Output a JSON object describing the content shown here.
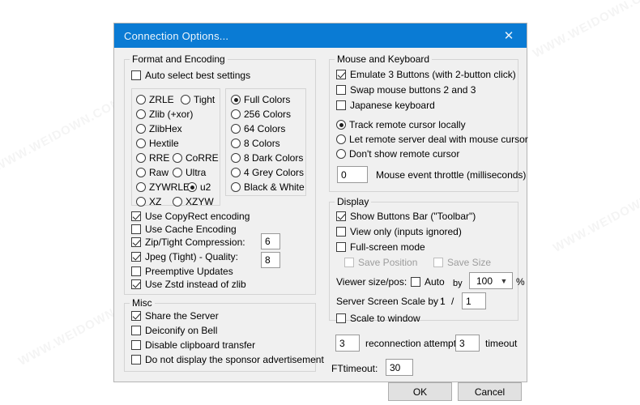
{
  "window": {
    "title": "Connection Options...",
    "close_icon": "close-icon",
    "titlebar_color": "#0a7bd4"
  },
  "format_group": {
    "legend": "Format and Encoding",
    "auto_select": {
      "label": "Auto select best settings",
      "checked": false
    },
    "encodings": [
      {
        "label": "ZRLE",
        "selected": false
      },
      {
        "label": "Tight",
        "selected": false
      },
      {
        "label": "Zlib (+xor)",
        "selected": false
      },
      {
        "label": "ZlibHex",
        "selected": false
      },
      {
        "label": "Hextile",
        "selected": false
      },
      {
        "label": "RRE",
        "selected": false
      },
      {
        "label": "CoRRE",
        "selected": false
      },
      {
        "label": "Raw",
        "selected": false
      },
      {
        "label": "Ultra",
        "selected": false
      },
      {
        "label": "ZYWRLE",
        "selected": false
      },
      {
        "label": "u2",
        "selected": true
      },
      {
        "label": "XZ",
        "selected": false
      },
      {
        "label": "XZYW",
        "selected": false
      }
    ],
    "colors": [
      {
        "label": "Full Colors",
        "selected": true
      },
      {
        "label": "256 Colors",
        "selected": false
      },
      {
        "label": "64 Colors",
        "selected": false
      },
      {
        "label": "8 Colors",
        "selected": false
      },
      {
        "label": "8 Dark Colors",
        "selected": false
      },
      {
        "label": "4 Grey Colors",
        "selected": false
      },
      {
        "label": "Black & White",
        "selected": false
      }
    ],
    "options": [
      {
        "label": "Use CopyRect encoding",
        "checked": true
      },
      {
        "label": "Use Cache Encoding",
        "checked": false
      },
      {
        "label": "Zip/Tight Compression:",
        "checked": true
      },
      {
        "label": "Jpeg (Tight) - Quality:",
        "checked": true
      },
      {
        "label": "Preemptive Updates",
        "checked": false
      },
      {
        "label": "Use Zstd instead of zlib",
        "checked": true
      }
    ],
    "compression_value": "6",
    "quality_value": "8"
  },
  "misc_group": {
    "legend": "Misc",
    "options": [
      {
        "label": "Share the Server",
        "checked": true
      },
      {
        "label": "Deiconify on Bell",
        "checked": false
      },
      {
        "label": "Disable clipboard transfer",
        "checked": false
      },
      {
        "label": "Do not display the sponsor advertisement",
        "checked": false
      }
    ]
  },
  "mouse_group": {
    "legend": "Mouse and Keyboard",
    "options": [
      {
        "label": "Emulate 3 Buttons (with 2-button click)",
        "checked": true
      },
      {
        "label": "Swap mouse buttons 2 and 3",
        "checked": false
      },
      {
        "label": "Japanese keyboard",
        "checked": false
      }
    ],
    "cursor_modes": [
      {
        "label": "Track remote cursor locally",
        "selected": true
      },
      {
        "label": "Let remote server deal with mouse cursor",
        "selected": false
      },
      {
        "label": "Don't show remote cursor",
        "selected": false
      }
    ],
    "throttle_value": "0",
    "throttle_label": "Mouse event throttle (milliseconds)"
  },
  "display_group": {
    "legend": "Display",
    "options": [
      {
        "label": "Show Buttons Bar (\"Toolbar\")",
        "checked": true,
        "disabled": false
      },
      {
        "label": "View only (inputs ignored)",
        "checked": false,
        "disabled": false
      },
      {
        "label": "Full-screen mode",
        "checked": false,
        "disabled": false
      }
    ],
    "save_position": {
      "label": "Save Position",
      "checked": false,
      "disabled": true
    },
    "save_size": {
      "label": "Save Size",
      "checked": false,
      "disabled": true
    },
    "viewer_size_label": "Viewer size/pos:",
    "auto_label": "Auto",
    "auto_checked": false,
    "by_label": "by",
    "zoom_value": "100",
    "percent_label": "%",
    "server_scale_label": "Server Screen Scale by :",
    "scale_numerator": "1",
    "scale_separator": "/",
    "scale_denominator": "1",
    "scale_to_window": {
      "label": "Scale to window",
      "checked": false
    }
  },
  "connection": {
    "reconnect_attempts": "3",
    "reconnect_label": "reconnection attempts",
    "timeout_value": "3",
    "timeout_label": "timeout",
    "ft_timeout_label": "FTtimeout:",
    "ft_timeout_value": "30"
  },
  "buttons": {
    "ok": "OK",
    "cancel": "Cancel"
  },
  "watermarks": [
    "WWW.WEIDOWN.COM",
    "WWW.WEIDOWN.COM",
    "WWW.WEIDOWN.COM",
    "WWW.WEIDOWN.COM",
    "WWW.WEIDOWN.COM",
    "WWW.WEIDOWN.COM"
  ]
}
